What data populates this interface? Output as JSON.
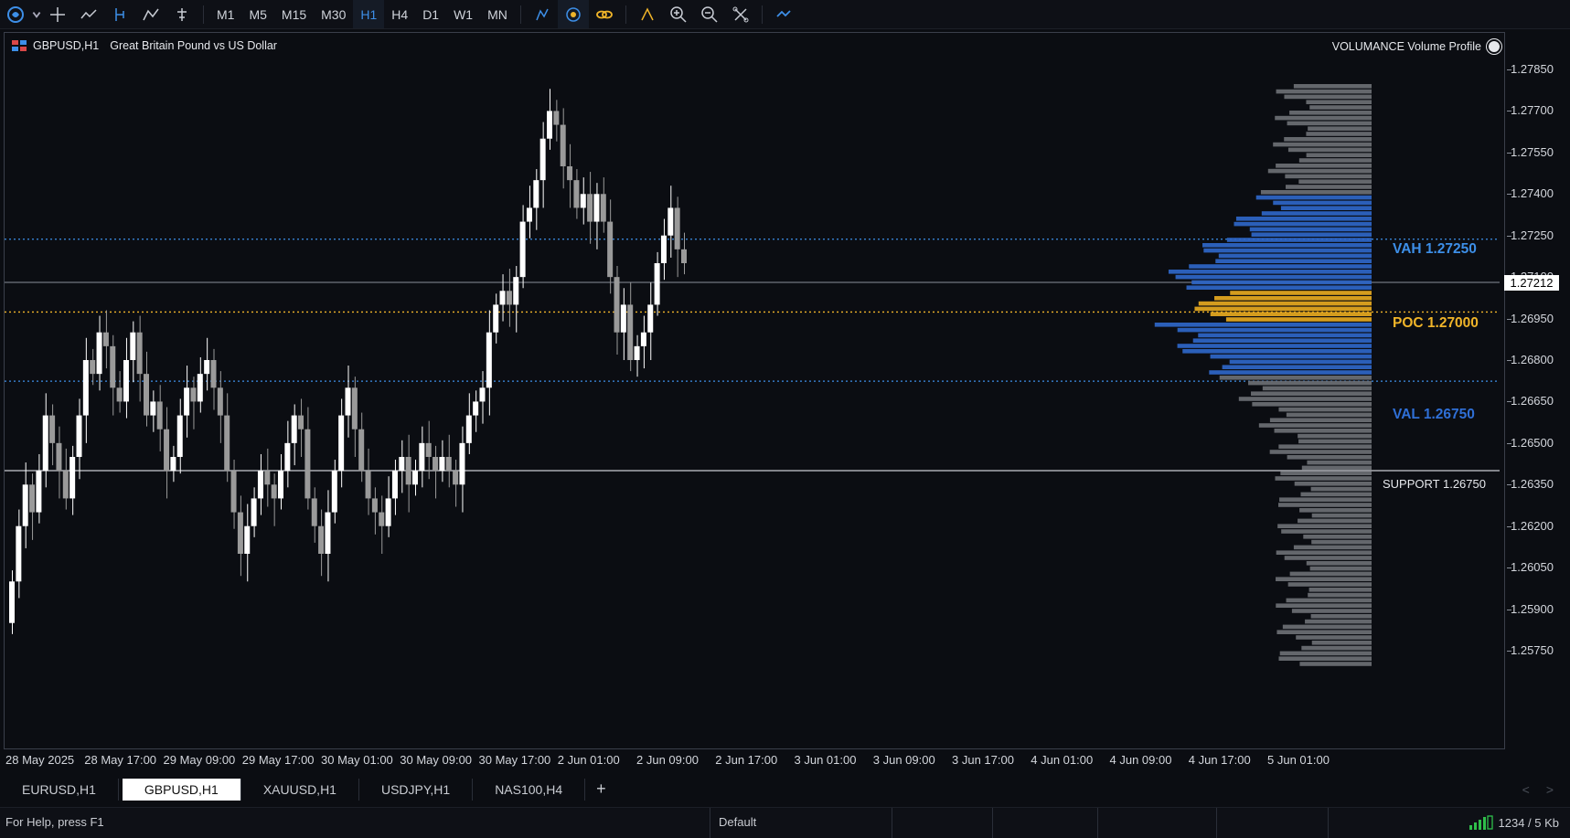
{
  "toolbar": {
    "timeframes": [
      "M1",
      "M5",
      "M15",
      "M30",
      "H1",
      "H4",
      "D1",
      "W1",
      "MN"
    ],
    "active_timeframe": "H1",
    "left_icons": [
      "globe-icon",
      "crosshair-icon",
      "line-tool-icon",
      "cursor-icon",
      "objects-icon",
      "settings-icon"
    ],
    "right_icons": [
      "chart-type-icon",
      "auto-scroll-icon",
      "link-icon",
      "indicators-icon",
      "zoom-in-icon",
      "zoom-out-icon",
      "grid-icon",
      "trade-icon"
    ]
  },
  "chart": {
    "symbol": "GBPUSD,H1",
    "description": "Great Britain Pound vs US Dollar",
    "indicator": "VOLUMANCE Volume Profile",
    "current_price": "1.27212"
  },
  "levels": {
    "vah": "VAH 1.27250",
    "poc": "POC 1.27000",
    "val": "VAL 1.26750",
    "support": "SUPPORT 1.26750"
  },
  "colors": {
    "background": "#0b0d12",
    "vah": "#3d8fe8",
    "poc": "#f0b429",
    "val": "#2f6fd6",
    "candle_up": "#ffffff",
    "candle_down": "#9a9a9a"
  },
  "y_ticks": [
    "1.27850",
    "1.27700",
    "1.27550",
    "1.27400",
    "1.27250",
    "1.27100",
    "1.26950",
    "1.26800",
    "1.26650",
    "1.26500",
    "1.26350",
    "1.26200",
    "1.26050",
    "1.25900",
    "1.25750"
  ],
  "x_ticks": [
    "28 May 2025",
    "28 May 17:00",
    "29 May 09:00",
    "29 May 17:00",
    "30 May 01:00",
    "30 May 09:00",
    "30 May 17:00",
    "2 Jun 01:00",
    "2 Jun 09:00",
    "2 Jun 17:00",
    "3 Jun 01:00",
    "3 Jun 09:00",
    "3 Jun 17:00",
    "4 Jun 01:00",
    "4 Jun 09:00",
    "4 Jun 17:00",
    "5 Jun 01:00"
  ],
  "tabs": [
    "EURUSD,H1",
    "GBPUSD,H1",
    "XAUUSD,H1",
    "USDJPY,H1",
    "NAS100,H4"
  ],
  "active_tab": "GBPUSD,H1",
  "status": {
    "help": "For Help, press F1",
    "profile": "Default",
    "traffic": "1234 / 5 Kb"
  },
  "chart_data": {
    "type": "candlestick",
    "ylim": [
      1.257,
      1.2795
    ],
    "closes": [
      1.26,
      1.262,
      1.2635,
      1.2625,
      1.264,
      1.266,
      1.265,
      1.264,
      1.263,
      1.2645,
      1.266,
      1.268,
      1.2675,
      1.269,
      1.2685,
      1.267,
      1.2665,
      1.268,
      1.269,
      1.2675,
      1.266,
      1.2665,
      1.2655,
      1.264,
      1.2645,
      1.266,
      1.267,
      1.2665,
      1.2675,
      1.268,
      1.267,
      1.266,
      1.264,
      1.2625,
      1.261,
      1.262,
      1.263,
      1.264,
      1.2635,
      1.263,
      1.264,
      1.265,
      1.266,
      1.2655,
      1.263,
      1.262,
      1.261,
      1.2625,
      1.264,
      1.266,
      1.267,
      1.2655,
      1.264,
      1.263,
      1.2625,
      1.262,
      1.263,
      1.264,
      1.2645,
      1.2635,
      1.264,
      1.265,
      1.2645,
      1.264,
      1.2645,
      1.264,
      1.2635,
      1.265,
      1.266,
      1.2665,
      1.267,
      1.269,
      1.27,
      1.2705,
      1.27,
      1.271,
      1.273,
      1.2735,
      1.2745,
      1.276,
      1.277,
      1.2765,
      1.275,
      1.2745,
      1.2735,
      1.274,
      1.273,
      1.274,
      1.273,
      1.271,
      1.269,
      1.27,
      1.268,
      1.2685,
      1.269,
      1.27,
      1.2715,
      1.2725,
      1.2735,
      1.272,
      1.2715
    ]
  }
}
